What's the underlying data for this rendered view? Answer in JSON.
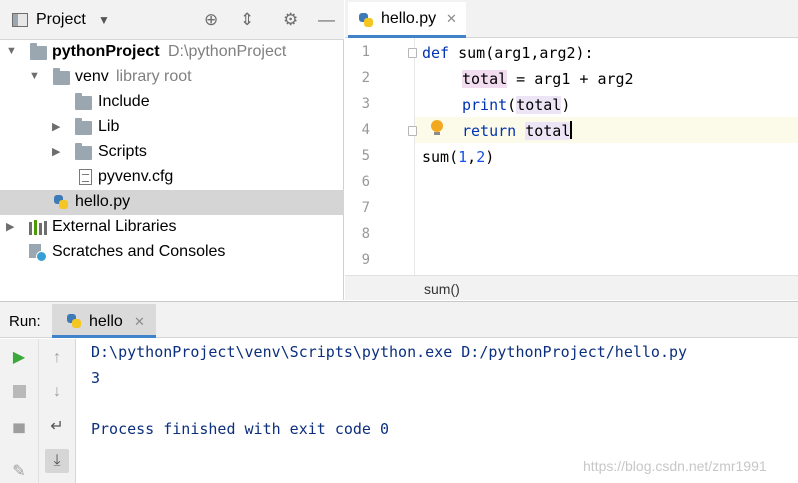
{
  "project_panel": {
    "title": "Project",
    "tree": [
      {
        "label": "pythonProject",
        "sub": "D:\\pythonProject"
      },
      {
        "label": "venv",
        "sub": "library root"
      },
      {
        "label": "Include"
      },
      {
        "label": "Lib"
      },
      {
        "label": "Scripts"
      },
      {
        "label": "pyvenv.cfg"
      },
      {
        "label": "hello.py"
      },
      {
        "label": "External Libraries"
      },
      {
        "label": "Scratches and Consoles"
      }
    ]
  },
  "editor": {
    "tab_label": "hello.py",
    "line_numbers": [
      "1",
      "2",
      "3",
      "4",
      "5",
      "6",
      "7",
      "8",
      "9"
    ],
    "code": {
      "l1_kw": "def",
      "l1_rest": " sum(arg1,arg2):",
      "l2_var": "total",
      "l2_rest": " = arg1 + arg2",
      "l3_fn": "print",
      "l3_open": "(",
      "l3_var": "total",
      "l3_close": ")",
      "l4_kw": "return",
      "l4_var": "total",
      "l5_fn": "sum(",
      "l5_n1": "1",
      "l5_comma": ",",
      "l5_n2": "2",
      "l5_close": ")"
    },
    "breadcrumb": "sum()"
  },
  "run_panel": {
    "label": "Run:",
    "tab_label": "hello",
    "console": [
      "D:\\pythonProject\\venv\\Scripts\\python.exe D:/pythonProject/hello.py",
      "3",
      "",
      "Process finished with exit code 0"
    ]
  },
  "watermark": "https://blog.csdn.net/zmr1991",
  "colors": {
    "keyword": "#0033b3",
    "number": "#1750eb",
    "console_text": "#0c2f7d",
    "selection": "#d5d5d5",
    "tab_underline": "#4083c9"
  }
}
